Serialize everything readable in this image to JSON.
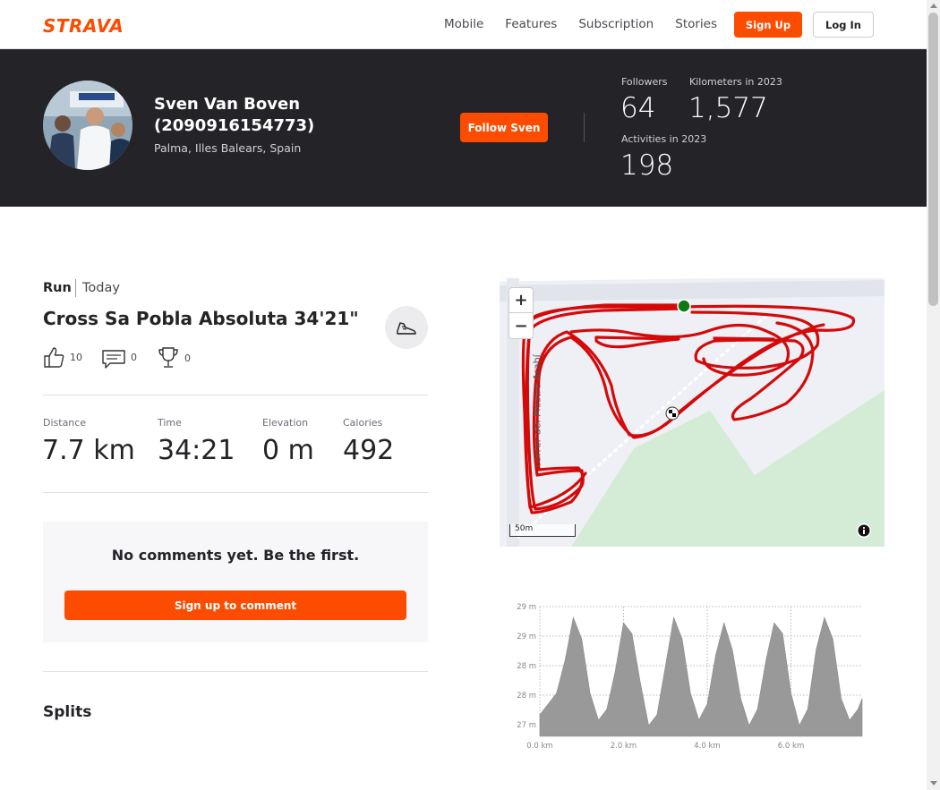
{
  "nav": {
    "brand": "STRAVA",
    "links": [
      "Mobile",
      "Features",
      "Subscription",
      "Stories"
    ],
    "signup_label": "Sign Up",
    "login_label": "Log In"
  },
  "athlete": {
    "name": "Sven Van Boven (2090916154773)",
    "location": "Palma, Illes Balears, Spain",
    "follow_label": "Follow Sven",
    "stats": {
      "followers_label": "Followers",
      "followers": "64",
      "km_label": "Kilometers in 2023",
      "km": "1,577",
      "activities_label": "Activities in 2023",
      "activities": "198"
    }
  },
  "activity": {
    "type": "Run",
    "date": "Today",
    "title": "Cross Sa Pobla Absoluta 34'21\"",
    "kudos": "10",
    "comments": "0",
    "achievements": "0",
    "metrics": [
      {
        "label": "Distance",
        "value": "7.7 km"
      },
      {
        "label": "Time",
        "value": "34:21"
      },
      {
        "label": "Elevation",
        "value": "0 m"
      },
      {
        "label": "Calories",
        "value": "492"
      }
    ]
  },
  "comments": {
    "empty_message": "No comments yet. Be the first.",
    "signup_label": "Sign up to comment"
  },
  "splits_title": "Splits",
  "map": {
    "street_label": "carrer del Mestre Arabí",
    "scale_label": "50m",
    "zoom_in": "+",
    "zoom_out": "−",
    "route_color": "#d40a0a",
    "park_color": "#d4ecd6"
  },
  "chart_data": {
    "type": "area",
    "title": "",
    "xlabel": "",
    "ylabel": "",
    "y_tick_labels": [
      "29 m",
      "29 m",
      "28 m",
      "28 m",
      "27 m"
    ],
    "x_tick_labels": [
      "0.0 km",
      "2.0 km",
      "4.0 km",
      "6.0 km"
    ],
    "xlim": [
      0,
      7.7
    ],
    "ylim": [
      26.8,
      29.2
    ],
    "x": [
      0.0,
      0.2,
      0.4,
      0.6,
      0.8,
      1.0,
      1.2,
      1.4,
      1.6,
      1.8,
      2.0,
      2.2,
      2.4,
      2.6,
      2.8,
      3.0,
      3.2,
      3.4,
      3.6,
      3.8,
      4.0,
      4.2,
      4.4,
      4.6,
      4.8,
      5.0,
      5.2,
      5.4,
      5.6,
      5.8,
      6.0,
      6.2,
      6.4,
      6.6,
      6.8,
      7.0,
      7.2,
      7.4,
      7.6,
      7.7
    ],
    "series": [
      {
        "values": [
          27.2,
          27.4,
          27.6,
          28.2,
          29.0,
          28.6,
          27.6,
          27.1,
          27.3,
          28.0,
          28.9,
          28.7,
          27.8,
          27.0,
          27.2,
          28.1,
          29.0,
          28.6,
          27.6,
          27.1,
          27.4,
          28.3,
          28.9,
          28.4,
          27.5,
          27.0,
          27.3,
          28.2,
          28.9,
          28.7,
          27.6,
          27.0,
          27.3,
          28.4,
          29.0,
          28.6,
          27.5,
          27.1,
          27.3,
          27.5
        ]
      }
    ]
  }
}
